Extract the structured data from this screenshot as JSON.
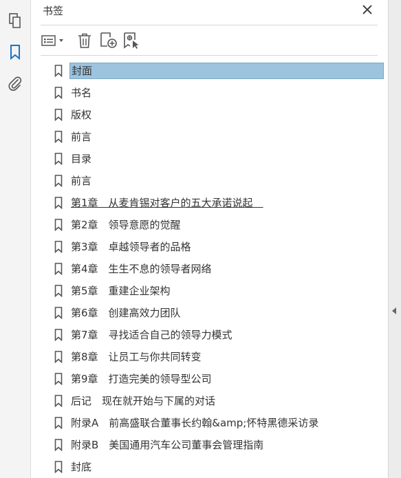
{
  "panel": {
    "title": "书签"
  },
  "toolbar": {
    "icons": [
      "options-menu-icon",
      "delete-icon",
      "new-bookmark-icon",
      "bookmark-from-selection-icon"
    ]
  },
  "rail": {
    "icons": [
      "page-thumbnails-icon",
      "bookmarks-icon",
      "attachments-icon"
    ]
  },
  "bookmarks": [
    {
      "label": "封面",
      "selected": true
    },
    {
      "label": "书名"
    },
    {
      "label": "版权"
    },
    {
      "label": "前言"
    },
    {
      "label": "目录"
    },
    {
      "label": "前言"
    },
    {
      "label": "第1章　从麦肯锡对客户的五大承诺说起　",
      "underlined": true
    },
    {
      "label": "第2章　领导意愿的觉醒"
    },
    {
      "label": "第3章　卓越领导者的品格"
    },
    {
      "label": "第4章　生生不息的领导者网络"
    },
    {
      "label": "第5章　重建企业架构"
    },
    {
      "label": "第6章　创建高效力团队"
    },
    {
      "label": "第7章　寻找适合自己的领导力模式"
    },
    {
      "label": "第8章　让员工与你共同转变"
    },
    {
      "label": "第9章　打造完美的领导型公司"
    },
    {
      "label": "后记　现在就开始与下属的对话"
    },
    {
      "label": "附录A　前高盛联合董事长约翰&amp;怀特黑德采访录"
    },
    {
      "label": "附录B　美国通用汽车公司董事会管理指南"
    },
    {
      "label": "封底"
    }
  ],
  "colors": {
    "selection": "#9dc3de",
    "accent": "#1a73c9"
  }
}
